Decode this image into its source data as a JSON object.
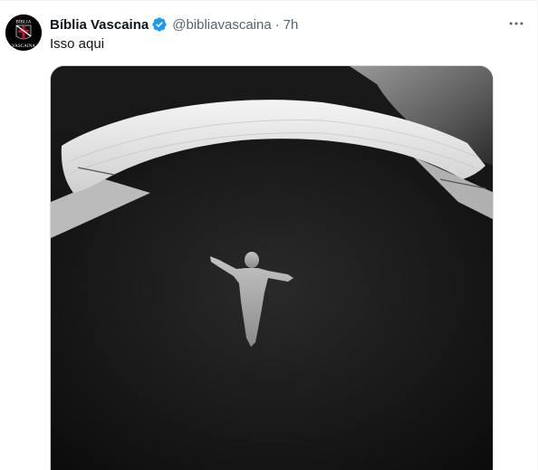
{
  "tweet": {
    "display_name": "Bíblia Vascaina",
    "handle": "@bibliavascaina",
    "separator": "·",
    "time": "7h",
    "text": "Isso aqui",
    "verified": true
  },
  "avatar": {
    "text_top": "BÍBLIA",
    "text_bottom": "VASCAINA",
    "icon": "cross-of-christ"
  },
  "media": {
    "description_icon": "jersey-photo"
  },
  "colors": {
    "text_primary": "#0f1419",
    "text_secondary": "#536471",
    "verified_blue": "#1d9bf0",
    "divider": "#eff3f4"
  }
}
